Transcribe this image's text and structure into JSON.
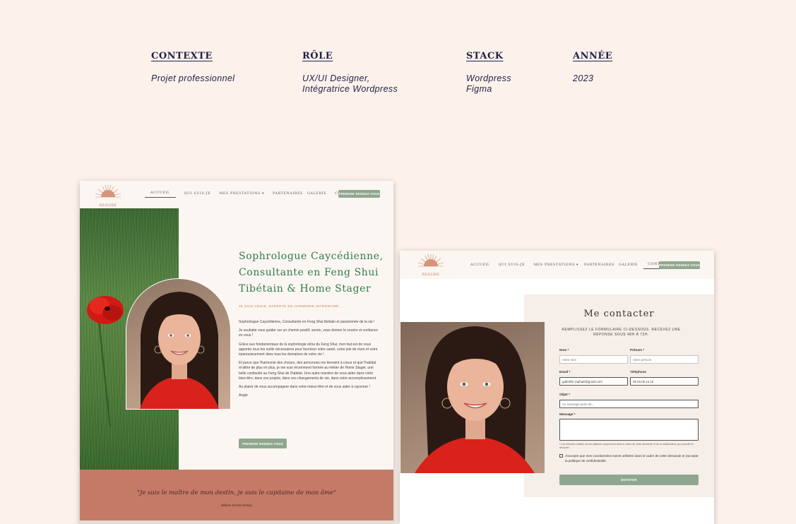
{
  "meta": {
    "context": {
      "label": "CONTEXTE",
      "value": "Projet professionnel"
    },
    "role": {
      "label": "RÔLE",
      "value_line1": "UX/UI Designer,",
      "value_line2": "Intégratrice Wordpress"
    },
    "stack": {
      "label": "STACK",
      "value_line1": "Wordpress",
      "value_line2": "Figma"
    },
    "year": {
      "label": "ANNÉE",
      "value": "2023"
    }
  },
  "home": {
    "logo_text": "RESSIRE",
    "nav": [
      "ACCUEIL",
      "QUI SUIS-JE",
      "MES PRESTATIONS",
      "PARTENAIRES",
      "GALERIE",
      "CONTACT"
    ],
    "nav_dropdown_glyph": "▾",
    "cta": "PRENDRE RENDEZ-VOUS",
    "hero_title": "Sophrologue Caycédienne, Consultante en Feng Shui Tibétain & Home Stager",
    "hero_subtitle": "JE SUIS ANGIE, EXPERTE EN HARMONIE INTÉRIEURE...",
    "paragraphs": [
      "Sophrologue Caycédienne, Consultante en Feng Shui tibétain et passionnée de la vie !",
      "Je souhaite vous guider sur un chemin positif, serein, vous donner le sourire et confiance en vous !",
      "Grâce aux fondamentaux de la sophrologie et/ou du Feng Shui, mon but est de vous apporter tous les outils nécessaires pour favoriser votre santé, votre joie de vivre et votre épanouissement dans tous les domaines de votre vie !",
      "Et parce que l'harmonie des choses, des personnes me tiennent à coeur et que l'habitat m'attire de plus en plus, je me suis récemment formée au métier de Home Stager, une belle continuité au Feng Shui de l'habitat. Une autre manière de vous aider dans votre bien-être, dans vos projets, dans vos changements de vie, dans votre accomplissement.",
      "Au plaisir de vous accompagner dans votre mieux-être et de vous aider à rayonner !",
      "Angie"
    ],
    "hero_button": "PRENDRE RENDEZ-VOUS",
    "quote": "\"Je suis le maître de mon destin, je suis le capitaine de mon âme\"",
    "quote_author": "William Ernest Henley"
  },
  "contact": {
    "logo_text": "RESSIRE",
    "nav": [
      "ACCUEIL",
      "QUI SUIS-JE",
      "MES PRESTATIONS",
      "PARTENAIRES",
      "GALERIE",
      "CONTACT"
    ],
    "nav_dropdown_glyph": "▾",
    "cta": "PRENDRE RENDEZ-VOUS",
    "title": "Me contacter",
    "intro": "REMPLISSEZ LE FORMULAIRE CI-DESSOUS. RECEVEZ UNE RÉPONSE SOUS 48H À 72H.",
    "fields": {
      "nom": {
        "label": "Nom *",
        "placeholder": "Votre nom"
      },
      "prenom": {
        "label": "Prénom *",
        "placeholder": "Votre prénom"
      },
      "email": {
        "label": "Email *",
        "value": "gabrielle.raphael@gmail.com"
      },
      "telephone": {
        "label": "Téléphone",
        "value": "06.03.05.12.16"
      },
      "objet": {
        "label": "Objet *",
        "placeholder": "Ce message parle de..."
      },
      "message": {
        "label": "Message *"
      }
    },
    "consent_note": "* Les données saisies seront utilisées uniquement dans le cadre de cette demande et de la collaboration qui pourrait en découler.",
    "consent_label": "J'accepte que mes coordonnées soient utilisées dans le cadre de cette demande et j'accepte la politique de confidentialité.",
    "submit": "ENVOYER"
  },
  "colors": {
    "page_bg": "#fdf1ec",
    "meta_text": "#1f2244",
    "accent_green": "#2f7a4a",
    "button_sage": "#8fa78e",
    "terracotta": "#c47a67"
  }
}
